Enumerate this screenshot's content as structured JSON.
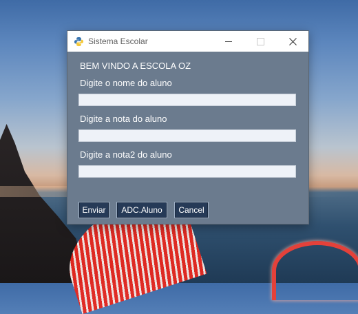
{
  "window": {
    "title": "Sistema Escolar",
    "icon": "python-icon",
    "controls": {
      "minimize": "minimize-icon",
      "maximize": "maximize-icon",
      "close": "close-icon"
    }
  },
  "form": {
    "welcome": "BEM VINDO A ESCOLA OZ",
    "fields": [
      {
        "label": "Digite o nome do aluno",
        "value": ""
      },
      {
        "label": "Digite a nota do aluno",
        "value": ""
      },
      {
        "label": "Digite a nota2 do aluno",
        "value": ""
      }
    ],
    "buttons": {
      "send": "Enviar",
      "add": "ADC.Aluno",
      "cancel": "Cancel"
    }
  },
  "colors": {
    "window_bg": "#6b7b8e",
    "button_bg": "#263a57",
    "field_bg": "#eef2f8"
  }
}
